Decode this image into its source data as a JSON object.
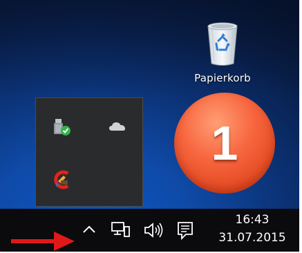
{
  "desktop": {
    "recycle_bin": {
      "label": "Papierkorb",
      "icon": "recycle-bin-icon"
    }
  },
  "tray_flyout": {
    "icons": [
      "usb-safely-remove-icon",
      "onedrive-cloud-icon",
      "ccleaner-icon"
    ]
  },
  "annotation": {
    "badge_number": "1",
    "badge_color": "#f2603a",
    "arrow_color": "#e01818"
  },
  "taskbar": {
    "icons": [
      "chevron-up-icon",
      "network-icon",
      "volume-icon",
      "action-center-icon"
    ],
    "clock": {
      "time": "16:43",
      "date": "31.07.2015"
    }
  }
}
